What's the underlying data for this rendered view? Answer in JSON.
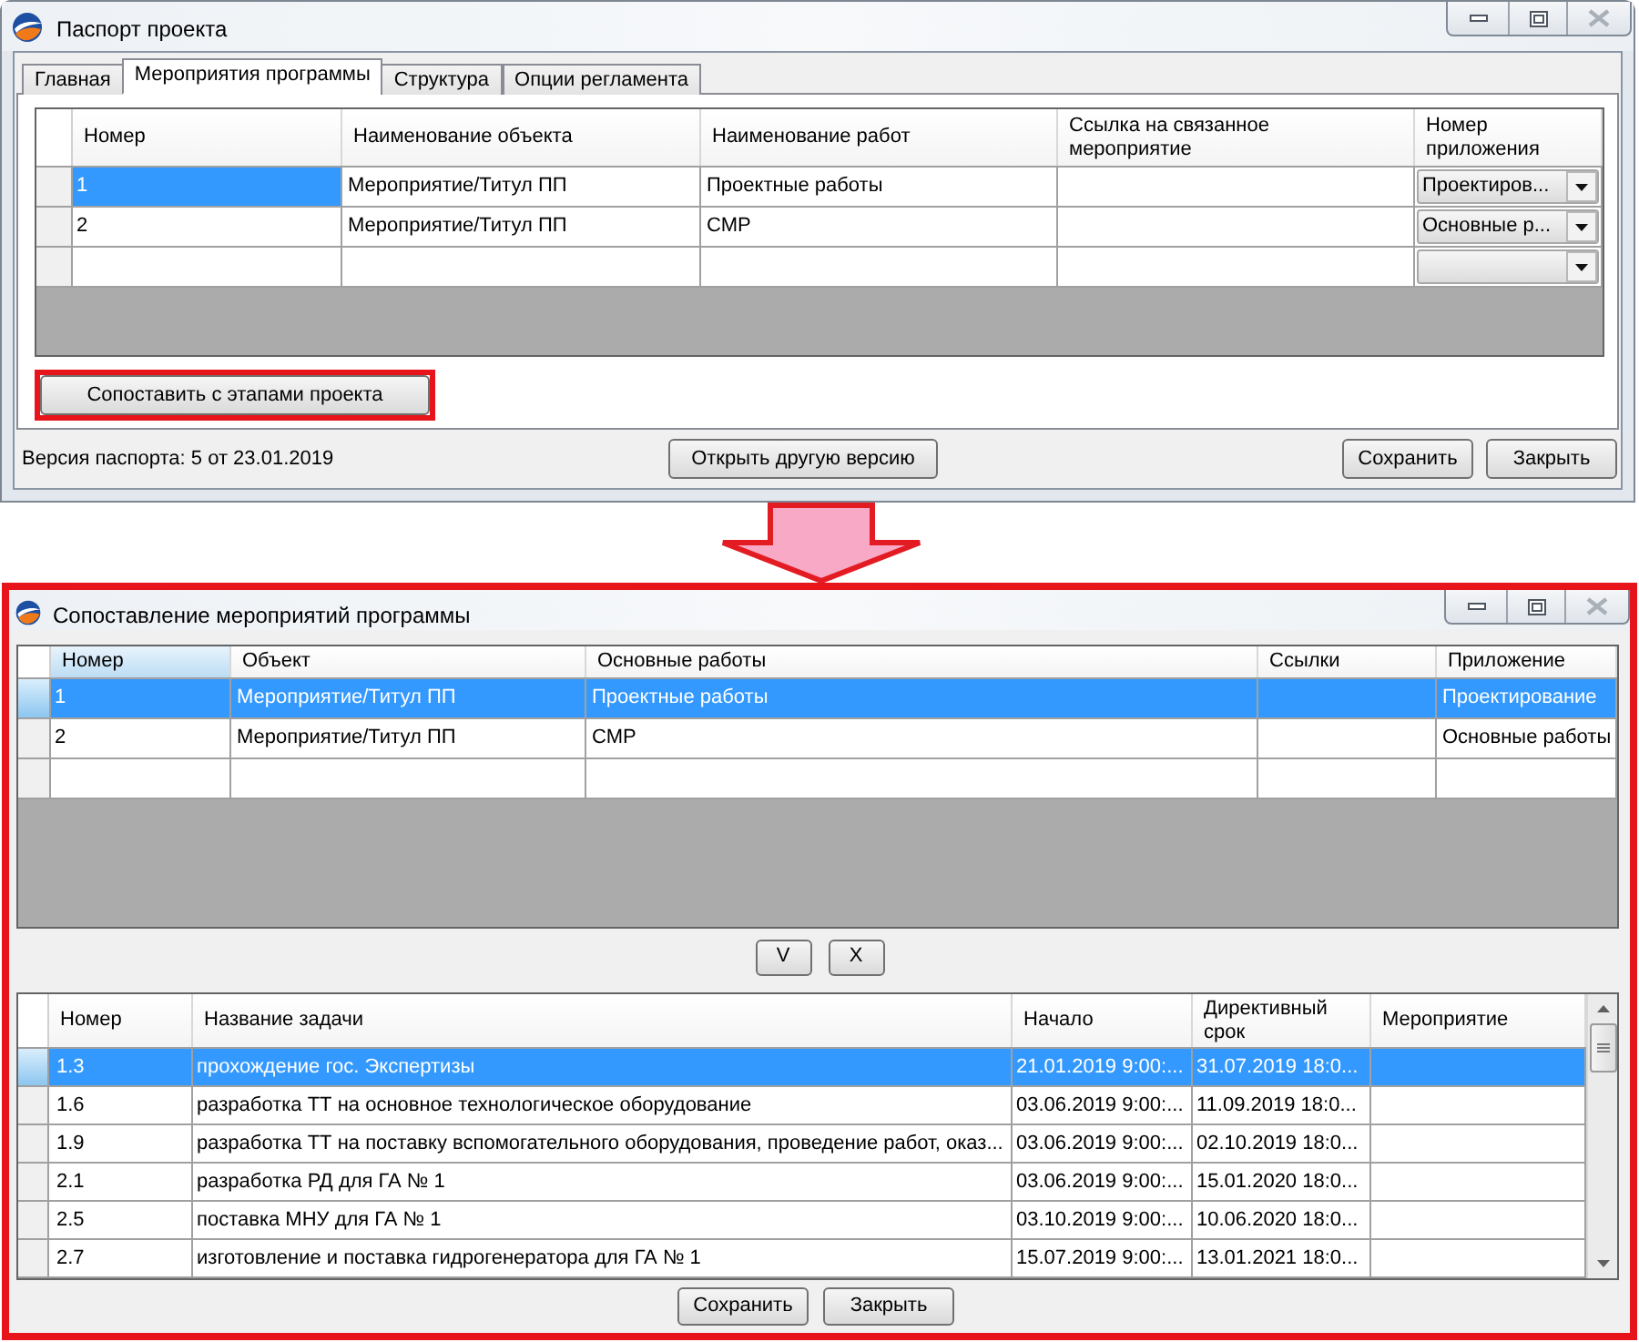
{
  "passport_window": {
    "title": "Паспорт проекта",
    "tabs": [
      {
        "label": "Главная",
        "selected": false
      },
      {
        "label": "Мероприятия программы",
        "selected": true
      },
      {
        "label": "Структура",
        "selected": false
      },
      {
        "label": "Опции регламента",
        "selected": false
      }
    ],
    "grid": {
      "full_row_select": false,
      "columns": [
        {
          "label": "Номер",
          "kind": "text",
          "highlighted": false
        },
        {
          "label": "Наименование объекта",
          "kind": "text",
          "highlighted": false
        },
        {
          "label": "Наименование работ",
          "kind": "text",
          "highlighted": false
        },
        {
          "label": "Ссылка на связанное мероприятие",
          "kind": "text",
          "highlighted": false
        },
        {
          "label": "Номер приложения",
          "kind": "dropdown",
          "highlighted": false
        }
      ],
      "rows": [
        {
          "selected": true,
          "number": "1",
          "object": "Мероприятие/Титул ПП",
          "work": "Проектные работы",
          "appendix": "Проектиров..."
        },
        {
          "selected": false,
          "number": "2",
          "object": "Мероприятие/Титул ПП",
          "work": "СМР",
          "appendix": "Основные р..."
        },
        {
          "selected": false
        }
      ]
    },
    "compare_button": {
      "label": "Сопоставить с этапами проекта",
      "highlighted": true
    },
    "footer": {
      "version": "Версия паспорта: 5 от 23.01.2019",
      "open_version_button": "Открыть другую версию",
      "buttons": [
        "Сохранить",
        "Закрыть"
      ]
    }
  },
  "mapping_window": {
    "title": "Сопоставление мероприятий программы",
    "highlighted": true,
    "events_grid": {
      "full_row_select": true,
      "columns": [
        {
          "label": "Номер",
          "kind": "text",
          "highlighted": true
        },
        {
          "label": "Объект",
          "kind": "text",
          "highlighted": false
        },
        {
          "label": "Основные работы",
          "kind": "text",
          "highlighted": false
        },
        {
          "label": "Ссылки",
          "kind": "text",
          "highlighted": false
        },
        {
          "label": "Приложение",
          "kind": "text",
          "highlighted": false
        }
      ],
      "rows": [
        {
          "selected": true,
          "number": "1",
          "object": "Мероприятие/Титул ПП",
          "main_work": "Проектные работы",
          "appendix": "Проектирование"
        },
        {
          "selected": false,
          "number": "2",
          "object": "Мероприятие/Титул ПП",
          "main_work": "СМР",
          "appendix": "Основные работы"
        },
        {
          "selected": false
        }
      ]
    },
    "move_buttons": [
      "V",
      "X"
    ],
    "tasks_grid": {
      "full_row_select": true,
      "columns": [
        {
          "label": "Номер",
          "kind": "text",
          "highlighted": false
        },
        {
          "label": "Название задачи",
          "kind": "text",
          "highlighted": false
        },
        {
          "label": "Начало",
          "kind": "text",
          "highlighted": false
        },
        {
          "label": "Директивный срок",
          "kind": "text",
          "highlighted": false
        },
        {
          "label": "Мероприятие",
          "kind": "text",
          "highlighted": false
        }
      ],
      "rows": [
        {
          "selected": true,
          "number": "1.3",
          "task": "прохождение гос. Экспертизы",
          "start": "21.01.2019 9:00:...",
          "deadline": "31.07.2019 18:0..."
        },
        {
          "selected": false,
          "number": "1.6",
          "task": "разработка ТТ на основное технологическое оборудование",
          "start": "03.06.2019 9:00:...",
          "deadline": "11.09.2019 18:0..."
        },
        {
          "selected": false,
          "number": "1.9",
          "task": "разработка ТТ на поставку вспомогательного оборудования, проведение работ, оказ...",
          "start": "03.06.2019 9:00:...",
          "deadline": "02.10.2019 18:0..."
        },
        {
          "selected": false,
          "number": "2.1",
          "task": "разработка РД для ГА № 1",
          "start": "03.06.2019 9:00:...",
          "deadline": "15.01.2020 18:0..."
        },
        {
          "selected": false,
          "number": "2.5",
          "task": "поставка МНУ для ГА № 1",
          "start": "03.10.2019 9:00:...",
          "deadline": "10.06.2020 18:0..."
        },
        {
          "selected": false,
          "number": "2.7",
          "task": "изготовление и поставка гидрогенератора для ГА № 1",
          "start": "15.07.2019 9:00:...",
          "deadline": "13.01.2021 18:0..."
        }
      ]
    },
    "buttons": [
      "Сохранить",
      "Закрыть"
    ]
  }
}
